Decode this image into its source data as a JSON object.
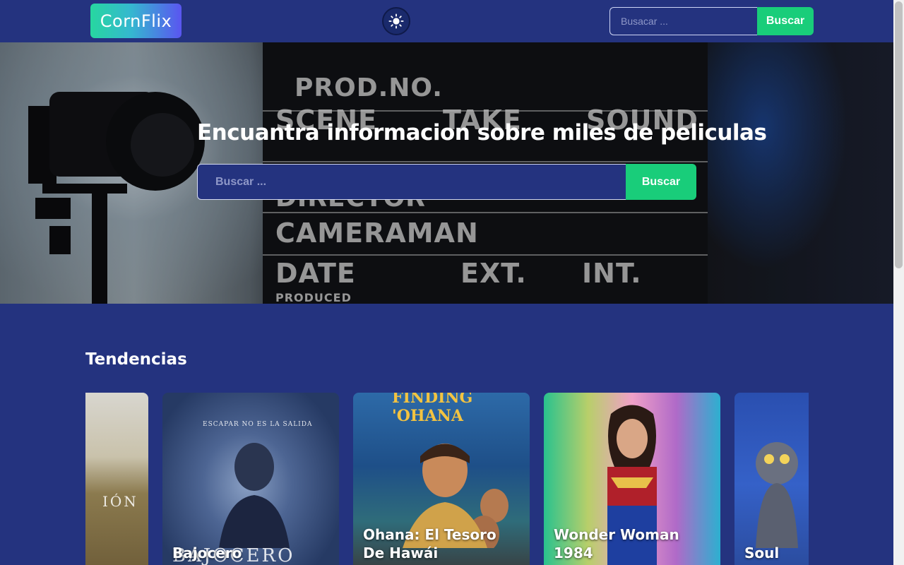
{
  "navbar": {
    "logo_text": "CornFlix",
    "theme_icon": "sun-icon",
    "search_placeholder": "Busacar ...",
    "search_button": "Buscar"
  },
  "hero": {
    "title": "Encuantra informacion sobre miles de peliculas",
    "search_placeholder": "Buscar ...",
    "search_button": "Buscar",
    "slate": {
      "prod_no": "PROD.NO.",
      "scene": "SCENE",
      "take": "TAKE",
      "sound": "SOUND",
      "director": "DIRECTOR",
      "cameraman": "CAMERAMAN",
      "date": "DATE",
      "ext": "EXT.",
      "int": "INT.",
      "produced": "PRODUCED"
    }
  },
  "trending": {
    "title": "Tendencias",
    "cards": [
      {
        "title": "",
        "poster_text": "IÓN"
      },
      {
        "title": "Bajocero",
        "poster_tagline": "ESCAPAR NO ES LA SALIDA",
        "poster_text": "BAJOCERO"
      },
      {
        "title": "Ohana: El Tesoro De Hawái",
        "poster_text": "FINDING 'OHANA"
      },
      {
        "title": "Wonder Woman 1984",
        "poster_text": ""
      },
      {
        "title": "Soul",
        "poster_text": ""
      }
    ]
  },
  "colors": {
    "background": "#24337f",
    "accent_green": "#19cd7a"
  }
}
